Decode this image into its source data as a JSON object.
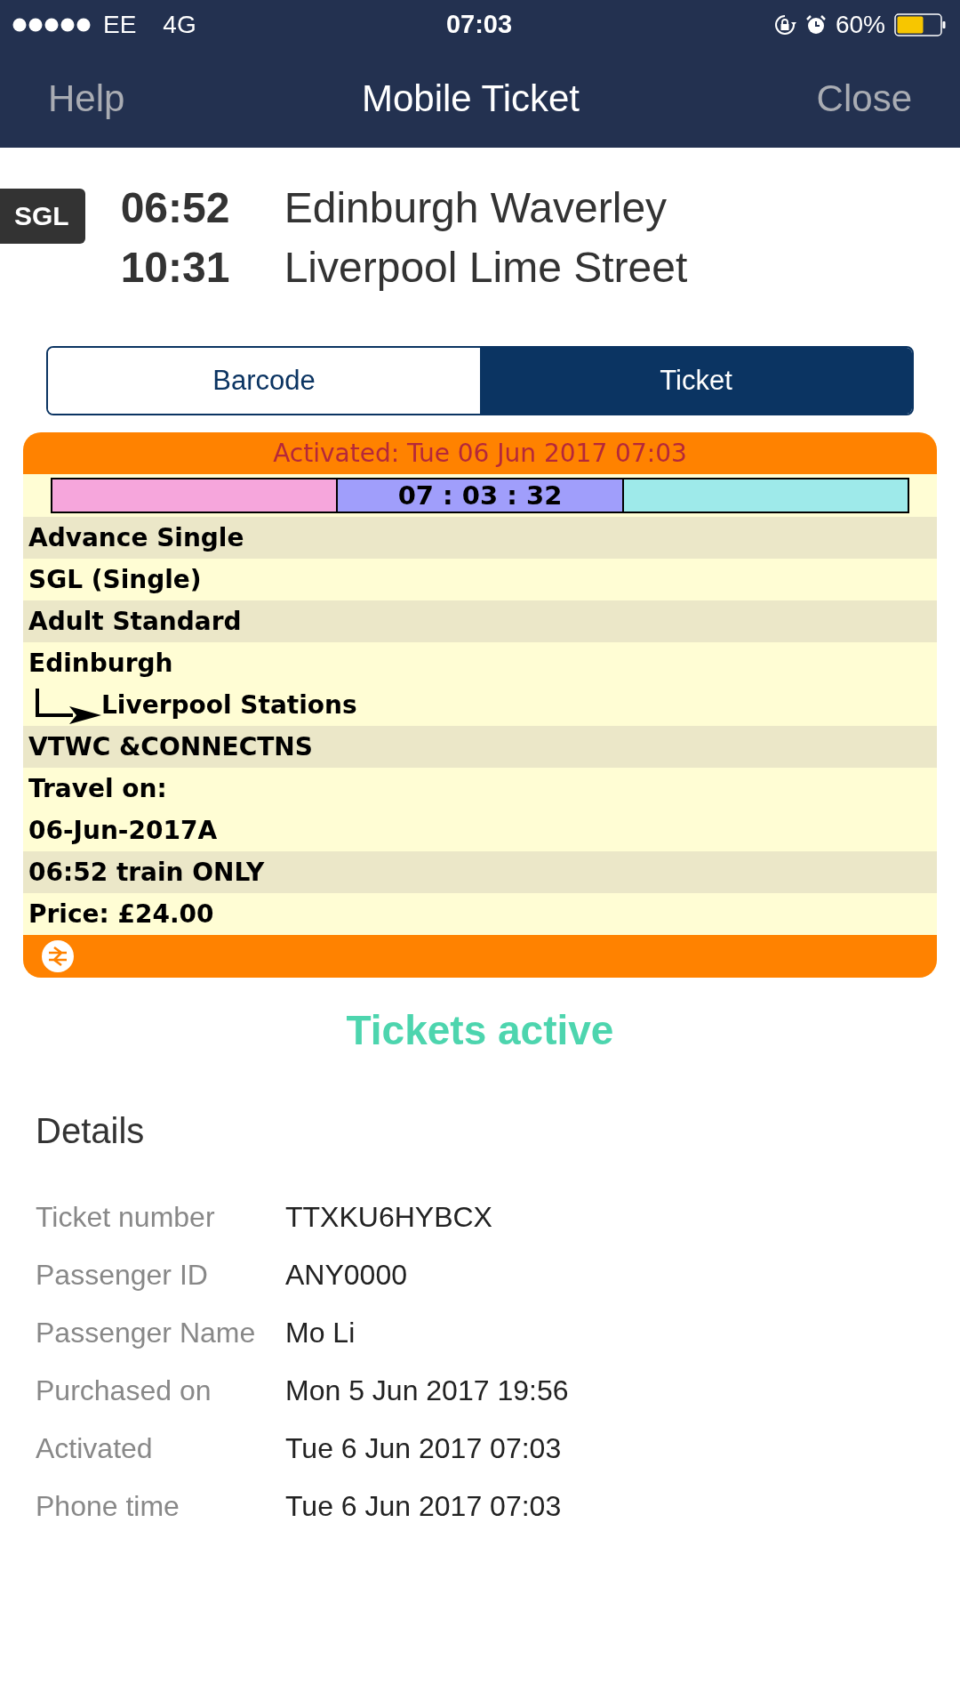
{
  "status_bar": {
    "carrier": "EE",
    "network": "4G",
    "time": "07:03",
    "battery": "60%"
  },
  "nav": {
    "left": "Help",
    "title": "Mobile Ticket",
    "right": "Close"
  },
  "journey": {
    "badge": "SGL",
    "stops": [
      {
        "time": "06:52",
        "station": "Edinburgh Waverley"
      },
      {
        "time": "10:31",
        "station": "Liverpool Lime Street"
      }
    ]
  },
  "tabs": [
    {
      "label": "Barcode",
      "selected": false
    },
    {
      "label": "Ticket",
      "selected": true
    }
  ],
  "ticket": {
    "activated": "Activated: Tue 06 Jun 2017 07:03",
    "timer": [
      {
        "color": "#f6a6dc"
      },
      {
        "color": "#a09efb",
        "text": "07 : 03 : 32"
      },
      {
        "color": "#9eeaea"
      }
    ],
    "groups": [
      {
        "lines": [
          {
            "kind": "plain",
            "text": "Advance Single"
          }
        ]
      },
      {
        "lines": [
          {
            "kind": "plain",
            "text": "SGL (Single)"
          }
        ]
      },
      {
        "lines": [
          {
            "kind": "plain",
            "text": "Adult Standard"
          }
        ]
      },
      {
        "lines": [
          {
            "kind": "plain",
            "text": "Edinburgh"
          },
          {
            "kind": "arrow",
            "text": "Liverpool Stations"
          }
        ]
      },
      {
        "lines": [
          {
            "kind": "plain",
            "text": "VTWC &CONNECTNS"
          }
        ]
      },
      {
        "lines": [
          {
            "kind": "plain",
            "text": "Travel on:"
          },
          {
            "kind": "plain",
            "text": "06-Jun-2017A"
          }
        ]
      },
      {
        "lines": [
          {
            "kind": "plain",
            "text": "06:52 train ONLY"
          }
        ]
      },
      {
        "lines": [
          {
            "kind": "plain",
            "text": "Price: £24.00"
          }
        ]
      }
    ]
  },
  "status": "Tickets active",
  "details": {
    "heading": "Details",
    "rows": [
      {
        "label": "Ticket number",
        "value": "TTXKU6HYBCX"
      },
      {
        "label": "Passenger ID",
        "value": "ANY0000"
      },
      {
        "label": "Passenger Name",
        "value": "Mo Li"
      },
      {
        "label": "Purchased on",
        "value": "Mon 5 Jun 2017 19:56"
      },
      {
        "label": "Activated",
        "value": "Tue 6 Jun 2017 07:03"
      },
      {
        "label": "Phone time",
        "value": "Tue 6 Jun 2017 07:03"
      }
    ]
  }
}
